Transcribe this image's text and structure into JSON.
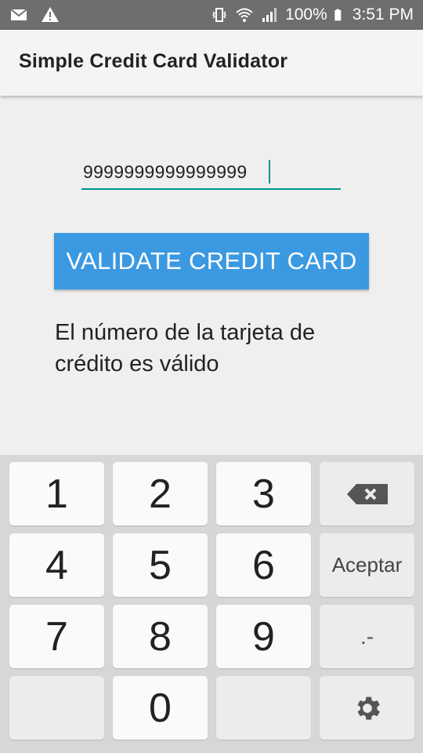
{
  "status_bar": {
    "battery": "100%",
    "time": "3:51 PM",
    "left_icons": [
      "mail-icon",
      "warning-icon"
    ],
    "right_icons": [
      "vibrate-icon",
      "wifi-icon",
      "signal-icon",
      "battery-icon"
    ]
  },
  "app_bar": {
    "title": "Simple Credit Card Validator"
  },
  "form": {
    "card_number": "9999999999999999",
    "validate_button": "VALIDATE CREDIT CARD",
    "result": "El número de la tarjeta de crédito es válido"
  },
  "keypad": {
    "keys": [
      "1",
      "2",
      "3",
      "4",
      "5",
      "6",
      "7",
      "8",
      "9",
      "0"
    ],
    "aceptar": "Aceptar",
    "punct": ".-"
  },
  "colors": {
    "accent": "#009688",
    "button": "#3b99e1",
    "status_bar": "#6e6e6e"
  }
}
